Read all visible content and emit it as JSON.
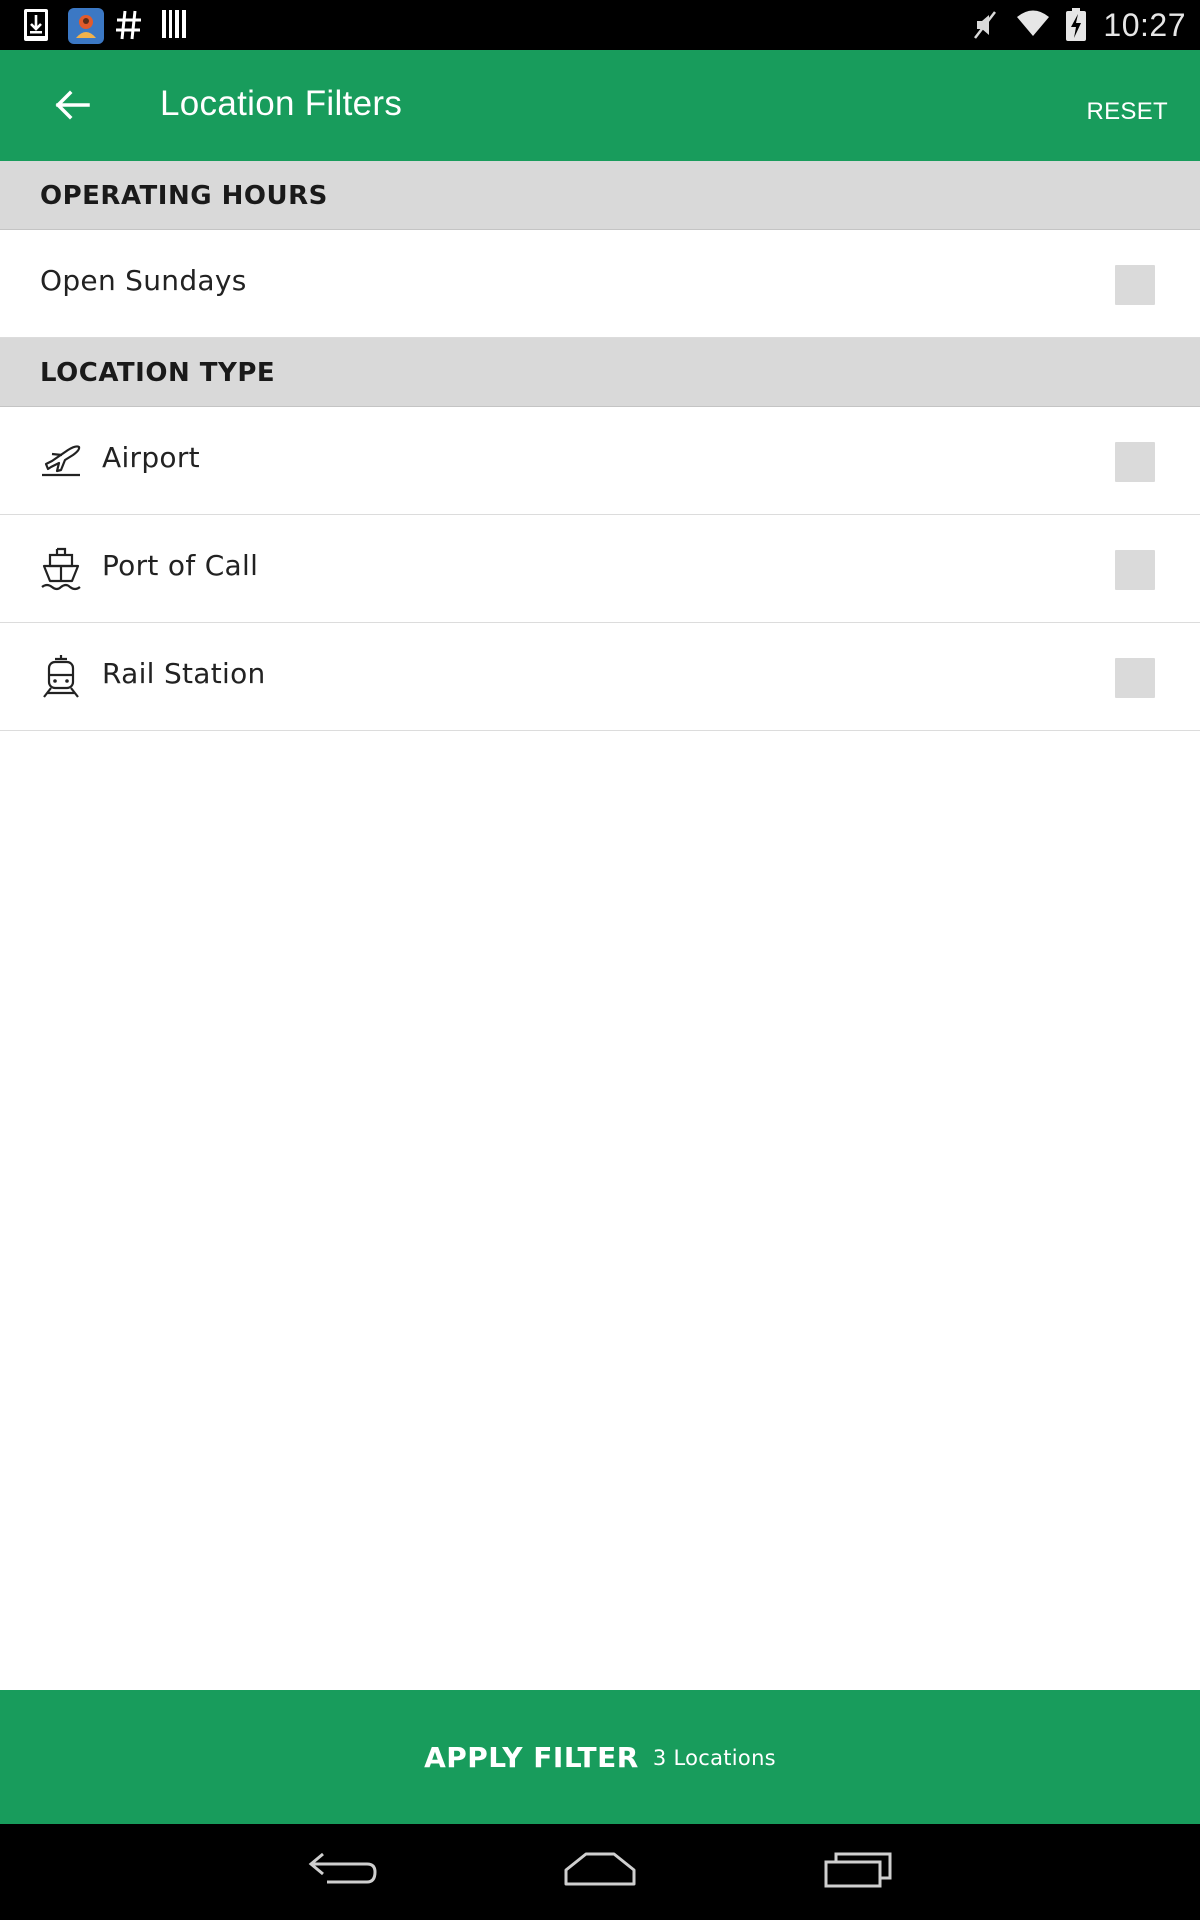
{
  "status_bar": {
    "time": "10:27",
    "left_icons": [
      "download-icon",
      "app-notification-icon",
      "hashtag-icon",
      "barcode-icon"
    ],
    "right_icons": [
      "mute-icon",
      "wifi-icon",
      "battery-charging-icon"
    ]
  },
  "app_bar": {
    "title": "Location Filters",
    "reset_label": "RESET",
    "background": "#189c5c"
  },
  "sections": {
    "operating_hours": {
      "title": "OPERATING HOURS",
      "items": [
        {
          "label": "Open Sundays",
          "checked": false
        }
      ]
    },
    "location_type": {
      "title": "LOCATION TYPE",
      "items": [
        {
          "label": "Airport",
          "icon": "airplane-icon",
          "checked": false
        },
        {
          "label": "Port of Call",
          "icon": "ship-icon",
          "checked": false
        },
        {
          "label": "Rail Station",
          "icon": "train-icon",
          "checked": false
        }
      ]
    }
  },
  "apply": {
    "label": "APPLY FILTER",
    "count": "3 Locations"
  },
  "nav_bar": {
    "buttons": [
      "back-nav-icon",
      "home-nav-icon",
      "recents-nav-icon"
    ]
  }
}
